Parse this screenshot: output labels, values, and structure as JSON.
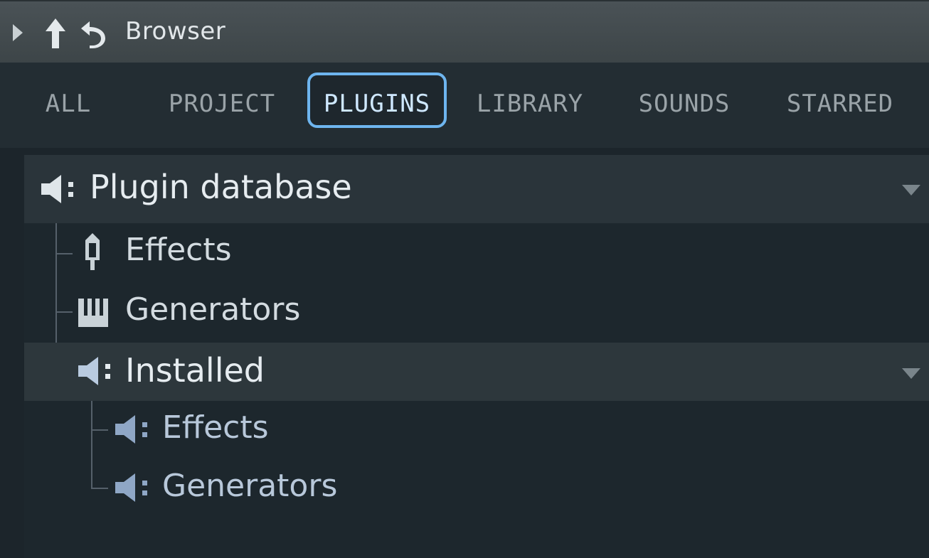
{
  "titlebar": {
    "title": "Browser",
    "icons": [
      "expand-arrow-icon",
      "up-arrow-icon",
      "undo-icon"
    ]
  },
  "tabs": [
    {
      "label": "ALL",
      "active": false
    },
    {
      "label": "PROJECT",
      "active": false
    },
    {
      "label": "PLUGINS",
      "active": true
    },
    {
      "label": "LIBRARY",
      "active": false
    },
    {
      "label": "SOUNDS",
      "active": false
    },
    {
      "label": "STARRED",
      "active": false
    }
  ],
  "tree": {
    "root": {
      "label": "Plugin database",
      "icon": "folder-speaker-icon"
    },
    "items": [
      {
        "label": "Effects",
        "icon": "plug-icon"
      },
      {
        "label": "Generators",
        "icon": "piano-keys-icon"
      },
      {
        "label": "Installed",
        "icon": "folder-speaker-icon"
      }
    ],
    "installed_children": [
      {
        "label": "Effects",
        "icon": "folder-speaker-icon"
      },
      {
        "label": "Generators",
        "icon": "folder-speaker-icon"
      }
    ]
  },
  "colors": {
    "accent": "#6eb5ef",
    "background": "#1d272d",
    "titlebar": "#444c50"
  }
}
